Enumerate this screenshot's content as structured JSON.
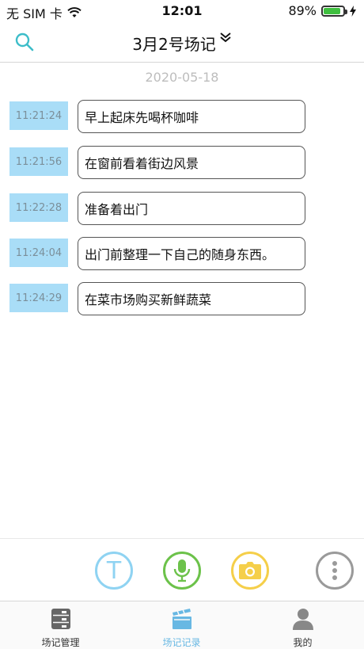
{
  "status_bar": {
    "carrier": "无 SIM 卡",
    "time": "12:01",
    "battery": "89%",
    "battery_level": 0.89,
    "wifi_icon": "wifi-icon"
  },
  "header": {
    "title": "3月2号场记",
    "search_icon": "search-icon",
    "dropdown_icon": "chevron-down-double-icon"
  },
  "date": "2020-05-18",
  "entries": [
    {
      "time": "11:21:24",
      "text": "早上起床先喝杯咖啡"
    },
    {
      "time": "11:21:56",
      "text": "在窗前看着街边风景"
    },
    {
      "time": "11:22:28",
      "text": "准备着出门"
    },
    {
      "time": "11:24:04",
      "text": "出门前整理一下自己的随身东西。"
    },
    {
      "time": "11:24:29",
      "text": "在菜市场购买新鲜蔬菜"
    }
  ],
  "toolbar": {
    "text_label": "T",
    "text_color": "#8fd3f2",
    "mic_color": "#6cc24a",
    "camera_color": "#f5cf4a",
    "more_color": "#9a9a9a"
  },
  "tabs": [
    {
      "label": "场记管理",
      "icon": "storage-icon"
    },
    {
      "label": "场记记录",
      "icon": "clapperboard-icon",
      "active": true
    },
    {
      "label": "我的",
      "icon": "user-icon"
    }
  ]
}
